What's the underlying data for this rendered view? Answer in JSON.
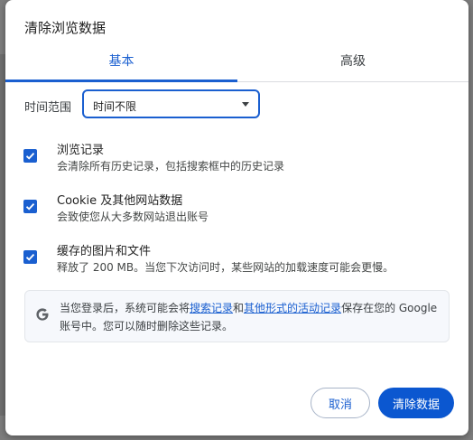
{
  "dialog": {
    "title": "清除浏览数据"
  },
  "tabs": [
    {
      "label": "基本",
      "active": true
    },
    {
      "label": "高级",
      "active": false
    }
  ],
  "time_range": {
    "label": "时间范围",
    "selected": "时间不限"
  },
  "options": [
    {
      "title": "浏览记录",
      "description": "会清除所有历史记录，包括搜索框中的历史记录",
      "checked": true
    },
    {
      "title": "Cookie 及其他网站数据",
      "description": "会致使您从大多数网站退出账号",
      "checked": true
    },
    {
      "title": "缓存的图片和文件",
      "description": "释放了 200 MB。当您下次访问时，某些网站的加载速度可能会更慢。",
      "checked": true
    }
  ],
  "info": {
    "text_before": "当您登录后，系统可能会将",
    "link_search": "搜索记录",
    "text_and": "和",
    "link_activity": "其他形式的活动记录",
    "text_after": "保存在您的 Google 账号中。您可以随时删除这些记录。"
  },
  "buttons": {
    "cancel": "取消",
    "clear": "清除数据"
  },
  "colors": {
    "accent": "#1a5fd0",
    "primary_button": "#0b57d0"
  }
}
